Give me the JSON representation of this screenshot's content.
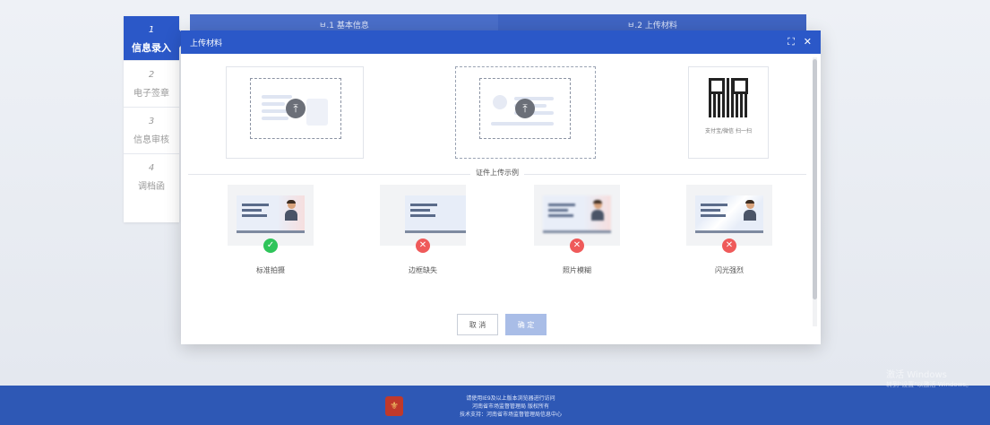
{
  "background": {
    "tabs": [
      "ㅂ.1 基本信息",
      "ㅂ.2 上传材料"
    ]
  },
  "steps": [
    {
      "num": "1",
      "label": "信息录入",
      "active": true
    },
    {
      "num": "2",
      "label": "电子签章",
      "active": false
    },
    {
      "num": "3",
      "label": "信息审核",
      "active": false
    },
    {
      "num": "4",
      "label": "调档函",
      "active": false
    }
  ],
  "modal": {
    "title": "上传材料",
    "expand_icon": "expand-icon",
    "close_icon": "close-icon",
    "qr_caption": "支付宝/微信 扫一扫",
    "divider": "证件上传示例",
    "examples": [
      {
        "label": "标准拍摄",
        "status": "ok"
      },
      {
        "label": "边框缺失",
        "status": "bad"
      },
      {
        "label": "照片模糊",
        "status": "bad"
      },
      {
        "label": "闪光强烈",
        "status": "bad"
      }
    ],
    "cancel_label": "取 消",
    "confirm_label": "确 定"
  },
  "footer": {
    "line1": "请使用IE9及以上版本浏览器进行访问",
    "line2": "河南省市场监督管理局 版权所有",
    "line3": "技术支持：河南省市场监督管理局信息中心"
  },
  "watermark": {
    "line1": "激活 Windows",
    "line2": "转到\"设置\"以激活 Windows。"
  },
  "colors": {
    "primary": "#2b58c8",
    "ok": "#2ec45a",
    "bad": "#ef5a5a",
    "footer": "#2e58b5"
  }
}
